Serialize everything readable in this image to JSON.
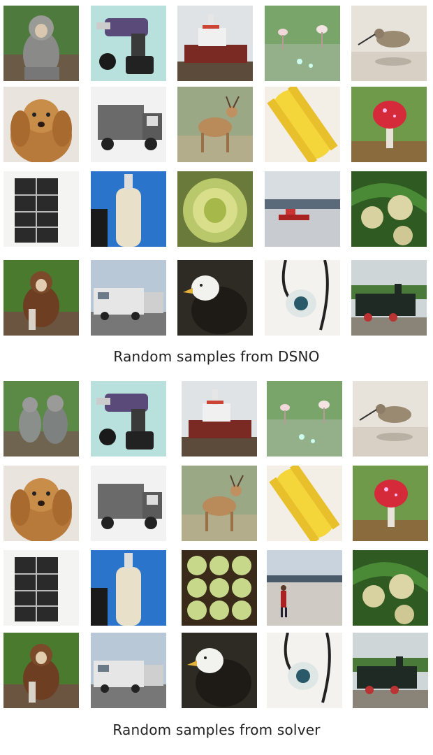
{
  "panels": [
    {
      "caption": "Random samples from DSNO",
      "rows": [
        [
          "monkey",
          "drill",
          "boat",
          "flamingos",
          "shorebird"
        ],
        [
          "dog",
          "truck",
          "deer",
          "corn",
          "mushroom"
        ],
        [
          "cabinet",
          "bottle",
          "artichoke",
          "harbor",
          "fruit"
        ],
        [
          "monkey2",
          "rv",
          "eagle",
          "bolo",
          "train"
        ]
      ]
    },
    {
      "caption": "Random samples from solver",
      "rows": [
        [
          "monkeys",
          "drill",
          "boat",
          "flamingos",
          "shorebird"
        ],
        [
          "dog",
          "truck",
          "deer",
          "corn",
          "mushroom"
        ],
        [
          "cabinet",
          "bottle",
          "artichoke-tray",
          "beach-person",
          "fruit"
        ],
        [
          "monkey2",
          "rv",
          "eagle",
          "bolo",
          "train"
        ]
      ]
    }
  ]
}
